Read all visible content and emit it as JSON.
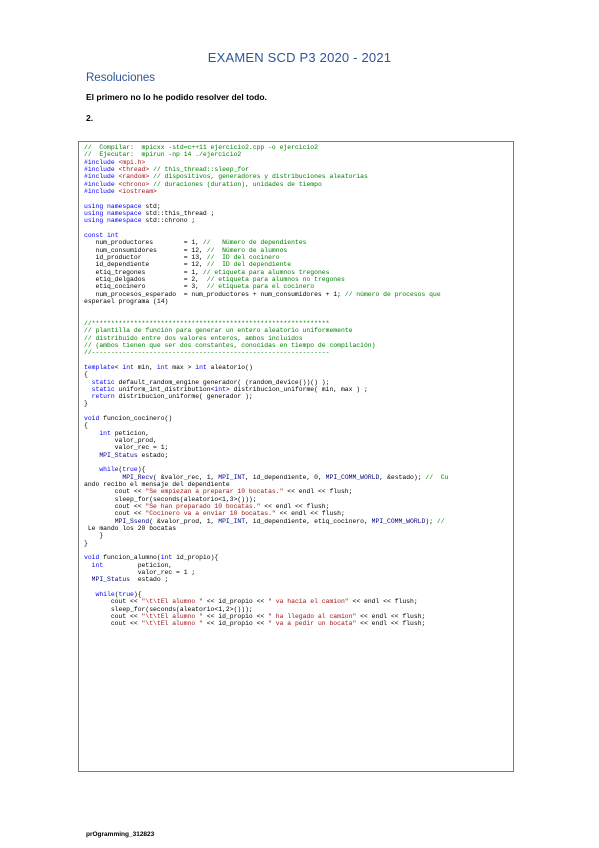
{
  "doc": {
    "title": "EXAMEN SCD P3 2020 - 2021",
    "subtitle": "Resoluciones",
    "paragraph_1": "El primero no lo he podido resolver del todo.",
    "paragraph_2": "2.",
    "footer": "prOgramming_312823"
  },
  "code_lines": [
    "//  Compilar:  mpicxx -std=c++11 ejercicio2.cpp -o ejercicio2",
    "//  Ejecutar:  mpirun -np 14 ./ejercicio2",
    "#include <mpi.h>",
    "#include <thread> // this_thread::sleep_for",
    "#include <random> // dispositivos, generadores y distribuciones aleatorias",
    "#include <chrono> // duraciones (duration), unidades de tiempo",
    "#include <iostream>",
    "",
    "using namespace std;",
    "using namespace std::this_thread ;",
    "using namespace std::chrono ;",
    "",
    "const int",
    "   num_productores        = 1, //   Número de dependientes",
    "   num_consumidores       = 12, //  Número de alumnos",
    "   id_productor           = 13, //  ID del cocinero",
    "   id_dependiente         = 12, //  ID del dependiente",
    "   etiq_tregones          = 1, // etiqueta para alumnos tregones",
    "   etiq_delgados          = 2,  // etiqueta para alumnos no tregones",
    "   etiq_cocinero          = 3,  // etiqueta para el cocinero",
    "   num_procesos_esperado  = num_productores + num_consumidores + 1; // número de procesos que",
    "esperael programa (14)",
    "",
    "",
    "//**************************************************************",
    "// plantilla de función para generar un entero aleatorio uniformemente",
    "// distribuido entre dos valores enteros, ambos incluidos",
    "// (ambos tienen que ser dos constantes, conocidas en tiempo de compilación)",
    "//--------------------------------------------------------------",
    "",
    "template< int min, int max > int aleatorio()",
    "{",
    "  static default_random_engine generador( (random_device())() );",
    "  static uniform_int_distribution<int> distribucion_uniforme( min, max ) ;",
    "  return distribucion_uniforme( generador );",
    "}",
    "",
    "void funcion_cocinero()",
    "{",
    "    int peticion,",
    "        valor_prod,",
    "        valor_rec = 1;",
    "    MPI_Status estado;",
    "",
    "    while(true){",
    "          MPI_Recv( &valor_rec, 1, MPI_INT, id_dependiente, 0, MPI_COMM_WORLD, &estado); //  Cu",
    "ando recibo el mensaje del dependiente",
    "        cout << \"Se empiezan a preparar 10 bocatas.\" << endl << flush;",
    "        sleep_for(seconds(aleatorio<1,3>()));",
    "        cout << \"Se han preparado 10 bocatas.\" << endl << flush;",
    "        cout << \"Cocinero va a enviar 10 bocatas.\" << endl << flush;",
    "        MPI_Ssend( &valor_prod, 1, MPI_INT, id_dependiente, etiq_cocinero, MPI_COMM_WORLD); //",
    " Le mando los 20 bocatas",
    "    }",
    "}",
    "",
    "void funcion_alumno(int id_propio){",
    "  int         peticion,",
    "              valor_rec = 1 ;",
    "  MPI_Status  estado ;",
    "",
    "   while(true){",
    "       cout << \"\\t\\tEl alumno \" << id_propio << \" va hacia el camion\" << endl << flush;",
    "       sleep_for(seconds(aleatorio<1,2>()));",
    "       cout << \"\\t\\tEl alumno \" << id_propio << \" ha llegado al camion\" << endl << flush;",
    "       cout << \"\\t\\tEl alumno \" << id_propio << \" va a pedir un bocata\" << endl << flush;"
  ]
}
